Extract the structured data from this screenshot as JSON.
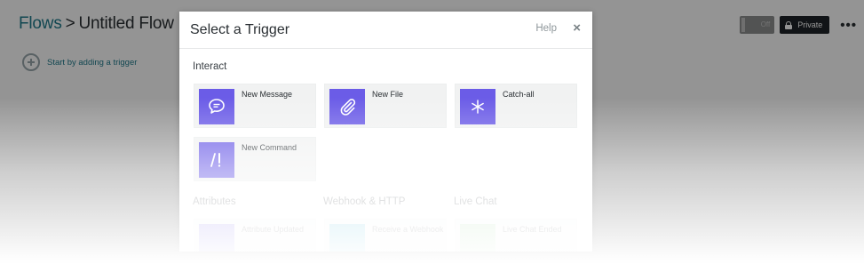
{
  "page": {
    "breadcrumb": {
      "parent": "Flows",
      "separator": ">",
      "current": "Untitled Flow"
    },
    "add_trigger_hint": "Start by adding a trigger",
    "toggle_label": "Off",
    "private_label": "Private",
    "more_label": "•••"
  },
  "modal": {
    "title": "Select a Trigger",
    "help_label": "Help",
    "close_label": "×",
    "sections": {
      "interact": {
        "title": "Interact",
        "items": [
          {
            "label": "New Message",
            "icon": "chat-bubble-icon"
          },
          {
            "label": "New File",
            "icon": "paperclip-icon"
          },
          {
            "label": "Catch-all",
            "icon": "asterisk-icon"
          },
          {
            "label": "New Command",
            "icon": "slash-command-icon"
          }
        ]
      },
      "attributes": {
        "title": "Attributes",
        "items": [
          {
            "label": "Attribute Updated"
          }
        ]
      },
      "webhook": {
        "title": "Webhook & HTTP",
        "items": [
          {
            "label": "Receive a Webhook"
          }
        ]
      },
      "livechat": {
        "title": "Live Chat",
        "items": [
          {
            "label": "Live Chat Ended"
          }
        ]
      }
    }
  },
  "colors": {
    "accent_purple": "#6b5ce7",
    "link_teal": "#1f7a8c",
    "private_button": "#1e2428"
  }
}
